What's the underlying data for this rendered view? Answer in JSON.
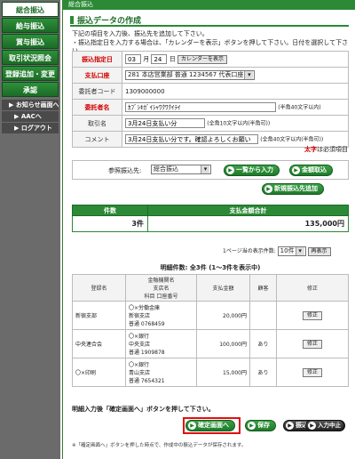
{
  "sidebar": {
    "items": [
      {
        "label": "総合振込"
      },
      {
        "label": "給与振込"
      },
      {
        "label": "賞与振込"
      },
      {
        "label": "取引状況照会"
      },
      {
        "label": "登録追加・変更"
      },
      {
        "label": "承認"
      }
    ],
    "subs": [
      {
        "label": "▶ お知らせ画面へ"
      },
      {
        "label": "▶ AACへ"
      },
      {
        "label": "▶ ログアウト"
      }
    ]
  },
  "topbar": {
    "label": "総合振込"
  },
  "page": {
    "title": "振込データの作成",
    "instr1": "下記の項目を入力後、振込先を追加して下さい。",
    "instr2": "・振込指定日を入力する場合は、「カレンダーを表示」ボタンを押して下さい。日付を選択して下さい。"
  },
  "form": {
    "date_label": "振込指定日",
    "date_month": "03",
    "date_month_unit": "月",
    "date_day": "24",
    "date_day_unit": "日",
    "calendar_button": "カレンダーを表示",
    "account_label": "支払口座",
    "account_value": "281 本店営業部 普通 1234567 代表口座",
    "client_code_label": "委託者コード",
    "client_code_value": "1309000000",
    "client_name_label": "委託者名",
    "client_name_value": "ｶﾌﾞｼｷｶﾞｲｼｬﾜｸﾜｸｲﾃｲ",
    "client_name_note": "(半角40文字以内)",
    "trade_label": "取引名",
    "trade_value": "3月24日支払い分",
    "trade_note": "(全角10文字以内(半角可))",
    "comment_label": "コメント",
    "comment_value": "3月24日支払い分です。確認よろしくお願い",
    "comment_note": "(全角40文字以内(半角可))"
  },
  "required_note": {
    "mark": "太字",
    "text": "は必須項目"
  },
  "reference": {
    "label": "参照振込先:",
    "value": "総合振込",
    "list_button": "一覧から入力",
    "amount_button": "金額取込",
    "new_button": "新規振込先追加"
  },
  "summary": {
    "count_header": "件数",
    "total_header": "支払金額合計",
    "count_value": "3件",
    "total_value": "135,000円",
    "per_page_label": "1ページ当の表示件数:",
    "per_page_value": "10件",
    "redisplay_button": "再表示"
  },
  "details": {
    "caption": "明細件数: 全3件 (1〜3件を表示中)",
    "headers": {
      "name": "登録名",
      "bank1": "金融機関名",
      "bank2": "支店名",
      "bank3": "科目 口座番号",
      "amount": "支払金額",
      "fee": "顧客",
      "edit": "修正"
    },
    "rows": [
      {
        "name": "新宿支部",
        "bank": "〇×労働金庫",
        "branch": "新宿支店",
        "acct": "普通 0768459",
        "amount": "20,000円",
        "fee": "",
        "edit": "修正"
      },
      {
        "name": "中央連合会",
        "bank": "〇×銀行",
        "branch": "中央支店",
        "acct": "普通 1909878",
        "amount": "100,000円",
        "fee": "あり",
        "edit": "修正"
      },
      {
        "name": "〇×印刷",
        "bank": "〇×銀行",
        "branch": "青山支店",
        "acct": "普通 7654321",
        "amount": "15,000円",
        "fee": "あり",
        "edit": "修正"
      }
    ]
  },
  "footer": {
    "instruction": "明細入力後「確定画面へ」ボタンを押して下さい。",
    "confirm_button": "確定画面へ",
    "save_button": "保存",
    "delete_button": "振込データ削除",
    "cancel_button": "入力中止",
    "note": "※「確定画面へ」ボタンを押した時点で、作成中の振込データが保存されます。"
  }
}
